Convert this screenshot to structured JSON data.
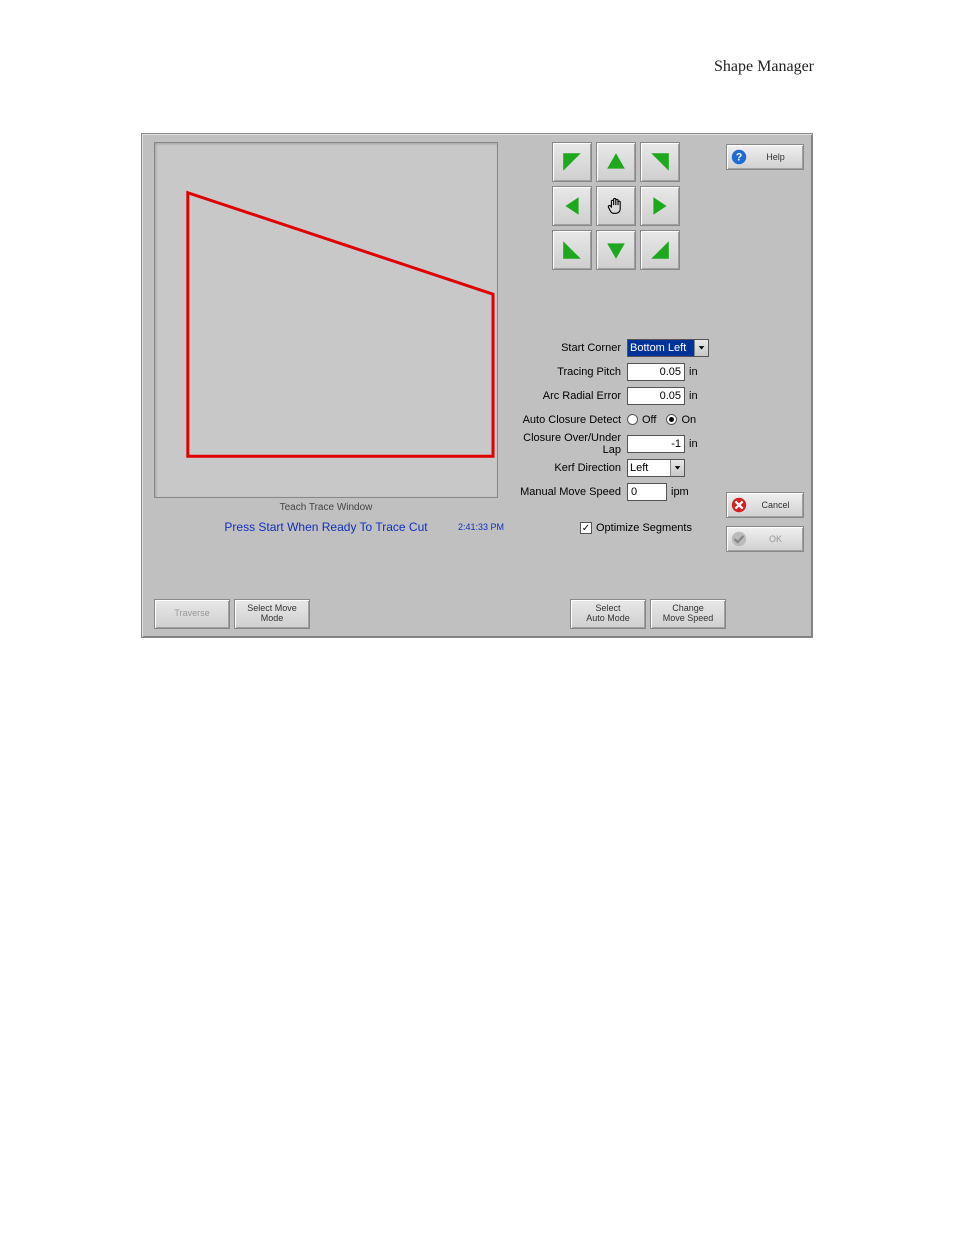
{
  "page": {
    "title": "Shape Manager"
  },
  "trace": {
    "caption": "Teach Trace Window",
    "status": "Press Start When Ready To Trace Cut",
    "time": "2:41:33 PM"
  },
  "dpad": {
    "nw": "up-left",
    "n": "up",
    "ne": "up-right",
    "w": "left",
    "c": "hand",
    "e": "right",
    "sw": "down-left",
    "s": "down",
    "se": "down-right"
  },
  "form": {
    "start_corner": {
      "label": "Start Corner",
      "value": "Bottom Left"
    },
    "tracing_pitch": {
      "label": "Tracing Pitch",
      "value": "0.05",
      "unit": "in"
    },
    "arc_radial_error": {
      "label": "Arc Radial Error",
      "value": "0.05",
      "unit": "in"
    },
    "auto_closure_detect": {
      "label": "Auto Closure Detect",
      "off": "Off",
      "on": "On",
      "value": "on"
    },
    "closure_lap": {
      "label": "Closure Over/Under Lap",
      "value": "-1",
      "unit": "in"
    },
    "kerf_direction": {
      "label": "Kerf Direction",
      "value": "Left"
    },
    "manual_move_speed": {
      "label": "Manual Move Speed",
      "value": "0",
      "unit": "ipm"
    },
    "optimize_segments": {
      "label": "Optimize Segments",
      "checked": true
    }
  },
  "right_buttons": {
    "help": "Help",
    "cancel": "Cancel",
    "ok": "OK"
  },
  "bottom_buttons": {
    "traverse": "Traverse",
    "select_move_mode": "Select Move Mode",
    "select_auto_mode": "Select\nAuto Mode",
    "change_move_speed": "Change\nMove Speed"
  }
}
